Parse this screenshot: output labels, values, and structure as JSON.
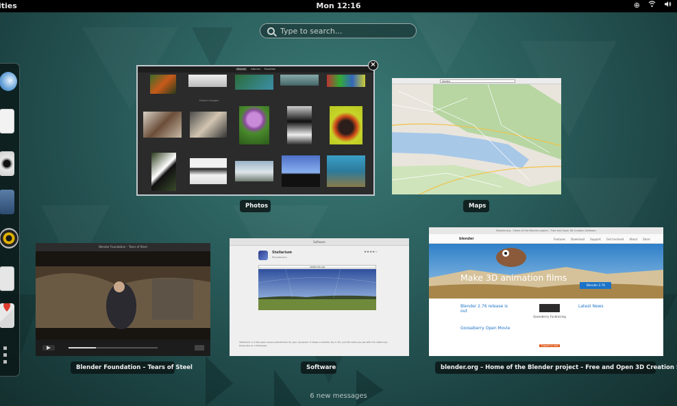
{
  "topbar": {
    "activities": "ities",
    "clock": "Mon 12:16",
    "tray": [
      "accessibility-icon",
      "wifi-icon",
      "volume-icon"
    ]
  },
  "search": {
    "placeholder": "Type to search..."
  },
  "dash": {
    "apps": [
      "web-browser-icon",
      "documents-icon",
      "camera-icon",
      "files-icon",
      "speaker-icon",
      "system-icon",
      "maps-pin-icon"
    ],
    "grid_button": "show-applications-icon"
  },
  "windows": {
    "photos": {
      "label": "Photos",
      "tabs": [
        "Recent",
        "Albums",
        "Favorites"
      ],
      "caption": "Dinkum Images"
    },
    "maps": {
      "label": "Maps",
      "search_value": "london"
    },
    "video": {
      "label": "Blender Foundation – Tears of Steel",
      "title": "Blender Foundation – Tears of Steel"
    },
    "software": {
      "label": "Software",
      "title": "Stellarium",
      "subtitle": "Planetarium",
      "site": "stellarium.org",
      "description": "Stellarium is a free open source planetarium for your computer. It shows a realistic sky in 3D, just like what you see with the naked eye, binoculars or a telescope."
    },
    "blender": {
      "label": "blender.org – Home of the Blender project – Free and Open 3D Creation Software",
      "title": "Blender.org – Home of the Blender project – Free and Open 3D Creation Software",
      "brand": "blender",
      "nav": [
        "Features",
        "Download",
        "Support",
        "Get Involved",
        "About",
        "Store"
      ],
      "banner_heading": "Make 3D animation films",
      "download_button": "Blender 2.76",
      "news_col1": "Blender 2.76 release is out",
      "news_col1_sub": "Gooseberry Open Movie",
      "news_col2": "Gooseberry Fundraising",
      "news_col2_btn": "Support us now",
      "news_col3": "Latest News"
    }
  },
  "footer": {
    "messages": "6 new messages"
  },
  "colors": {
    "topbar": "#000000",
    "backdrop": "#2a5e5c",
    "label_bg": "#0c1616",
    "blender_accent": "#1b73c7"
  }
}
